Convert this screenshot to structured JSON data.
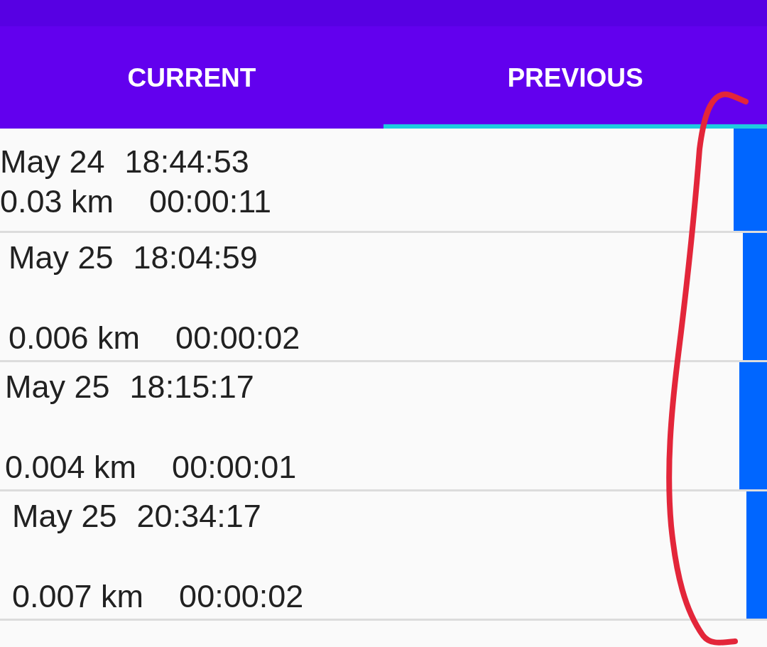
{
  "tabs": [
    {
      "label": "CURRENT",
      "selected": false
    },
    {
      "label": "PREVIOUS",
      "selected": true
    }
  ],
  "trips": [
    {
      "kind": "compact",
      "date": "May 24",
      "time": "18:44:53",
      "distance": "0.03 km",
      "duration": "00:00:11"
    },
    {
      "kind": "standard",
      "date": "May 25",
      "time": "18:04:59",
      "distance": "0.006 km",
      "duration": "00:00:02"
    },
    {
      "kind": "standard",
      "date": "May 25",
      "time": "18:15:17",
      "distance": "0.004 km",
      "duration": "00:00:01"
    },
    {
      "kind": "standard",
      "date": "May 25",
      "time": "20:34:17",
      "distance": "0.007 km",
      "duration": "00:00:02"
    }
  ]
}
